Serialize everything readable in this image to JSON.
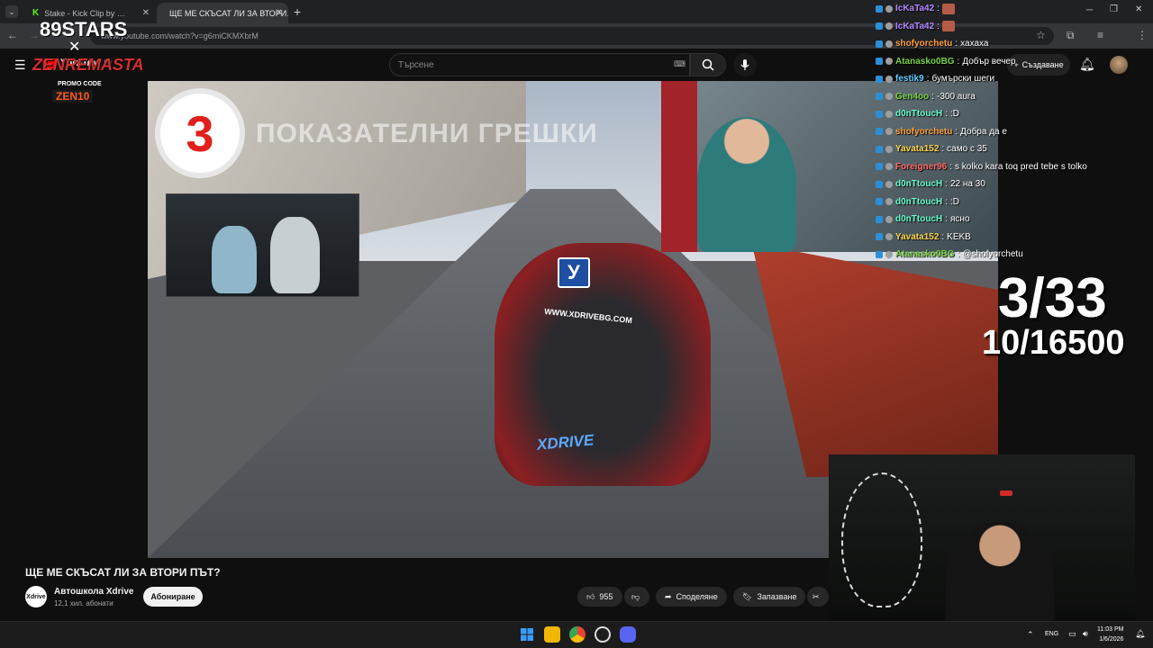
{
  "browser": {
    "tabs": [
      {
        "label": "Stake - Kick Clip by …",
        "active": false
      },
      {
        "label": "ЩЕ МЕ СКЪСАТ ЛИ ЗА ВТОРИ…",
        "active": true
      }
    ],
    "url": "www.youtube.com/watch?v=g6miCKMXbrM"
  },
  "youtube": {
    "logo": "YouTube",
    "region": "BG",
    "search_placeholder": "Търсене",
    "create_label": "Създаване"
  },
  "video": {
    "title": "ЩЕ МЕ СКЪСАТ ЛИ ЗА ВТОРИ ПЪТ?",
    "overlay_number": "3",
    "overlay_text": "ПОКАЗАТЕЛНИ ГРЕШКИ",
    "car_sign": "У",
    "car_brand": "XDRIVE",
    "car_site": "WWW.XDRIVEBG.COM"
  },
  "channel": {
    "name": "Автошкола Xdrive",
    "avatar_text": "Xdrive",
    "subscribers": "12,1 хил. абонати",
    "subscribe_label": "Абониране"
  },
  "actions": {
    "likes": "955",
    "share_label": "Споделяне",
    "save_label": "Запазване"
  },
  "stream_overlay": {
    "sponsor_top": "89STARS",
    "sponsor_brand": "ZENREMASTA",
    "promo_label": "PROMO CODE",
    "promo_code": "ZEN10",
    "counter_main": "3/33",
    "counter_sub": "10/16500"
  },
  "chat": [
    {
      "user": "IcKaTa42",
      "color": "#b388ff",
      "msg": ""
    },
    {
      "user": "IcKaTa42",
      "color": "#b388ff",
      "msg": ""
    },
    {
      "user": "shofyorchetu",
      "color": "#ff9f40",
      "msg": "хахаха"
    },
    {
      "user": "Atanasko0BG",
      "color": "#7bd148",
      "msg": "Добър вечер"
    },
    {
      "user": "festik9",
      "color": "#66ccff",
      "msg": "бумърски шеги"
    },
    {
      "user": "Gen4oo",
      "color": "#7bd148",
      "msg": "-300 aura"
    },
    {
      "user": "d0nTtoucH",
      "color": "#66ffcc",
      "msg": ":D"
    },
    {
      "user": "shofyorchetu",
      "color": "#ff9f40",
      "msg": "Добра да е"
    },
    {
      "user": "Yavata152",
      "color": "#ffd54f",
      "msg": "само с 35"
    },
    {
      "user": "Foreigner96",
      "color": "#ff6b6b",
      "msg": "s kolko kara toq pred tebe s tolko"
    },
    {
      "user": "d0nTtoucH",
      "color": "#66ffcc",
      "msg": "22 на 30"
    },
    {
      "user": "d0nTtoucH",
      "color": "#66ffcc",
      "msg": ":D"
    },
    {
      "user": "d0nTtoucH",
      "color": "#66ffcc",
      "msg": "ясно"
    },
    {
      "user": "Yavata152",
      "color": "#ffd54f",
      "msg": "KEKB"
    },
    {
      "user": "Atanasko0BG",
      "color": "#7bd148",
      "msg": "@shofyorchetu"
    }
  ],
  "taskbar": {
    "language": "ENG",
    "time": "11:03 PM",
    "date": "1/6/2026"
  },
  "colors": {
    "youtube_red": "#ff0000",
    "stream_brand_red": "#d32f2f"
  }
}
